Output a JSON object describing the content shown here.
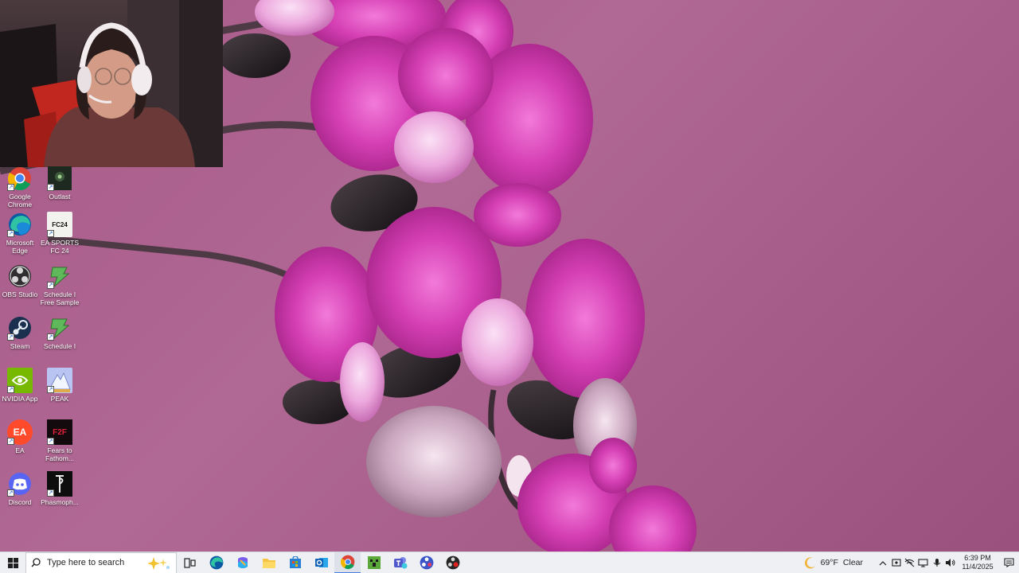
{
  "desktop": {
    "icons": [
      {
        "label": "Google Chrome",
        "icon": "chrome-icon"
      },
      {
        "label": "Outlast",
        "icon": "outlast-icon"
      },
      {
        "label": "Microsoft Edge",
        "icon": "edge-icon"
      },
      {
        "label": "EA SPORTS FC 24",
        "icon": "ea-fc24-icon",
        "badge": "FC24"
      },
      {
        "label": "OBS Studio",
        "icon": "obs-icon"
      },
      {
        "label": "Schedule I Free Sample",
        "icon": "schedule-i-icon"
      },
      {
        "label": "Steam",
        "icon": "steam-icon"
      },
      {
        "label": "Schedule I",
        "icon": "schedule-i-icon"
      },
      {
        "label": "NVIDIA App",
        "icon": "nvidia-icon"
      },
      {
        "label": "PEAK",
        "icon": "peak-icon"
      },
      {
        "label": "EA",
        "icon": "ea-icon",
        "badge": "EA"
      },
      {
        "label": "Fears to Fathom...",
        "icon": "fears-to-fathom-icon",
        "badge": "F2F"
      },
      {
        "label": "Discord",
        "icon": "discord-icon"
      },
      {
        "label": "Phasmoph...",
        "icon": "phasmophobia-icon"
      }
    ]
  },
  "taskbar": {
    "search_placeholder": "Type here to search",
    "pinned": [
      {
        "icon": "task-view-icon"
      },
      {
        "icon": "edge-icon"
      },
      {
        "icon": "copilot-icon"
      },
      {
        "icon": "file-explorer-icon"
      },
      {
        "icon": "microsoft-store-icon"
      },
      {
        "icon": "outlook-icon"
      },
      {
        "icon": "chrome-icon",
        "active": true
      },
      {
        "icon": "minecraft-icon"
      },
      {
        "icon": "teams-icon"
      },
      {
        "icon": "obs-icon"
      },
      {
        "icon": "obs-dark-icon"
      }
    ],
    "weather": {
      "temp": "69°F",
      "condition": "Clear",
      "icon": "moon-icon"
    },
    "clock": {
      "time": "6:39 PM",
      "date": "11/4/2025"
    }
  },
  "colors": {
    "wallpaper": "#a85a88",
    "taskbar": "#eef0f4",
    "accent": "#4a7ee0"
  }
}
